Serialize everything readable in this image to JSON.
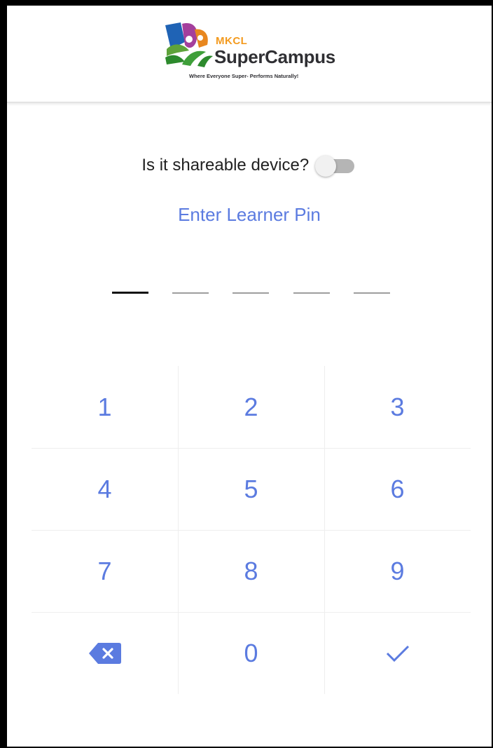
{
  "header": {
    "logo_mkcl": "MKCL",
    "logo_name": "SuperCampus",
    "logo_tagline": "Where Everyone Super- Performs Naturally!"
  },
  "share": {
    "label": "Is it shareable device?",
    "toggle_on": false
  },
  "pin": {
    "title": "Enter Learner Pin",
    "length": 5,
    "active_index": 0
  },
  "keypad": {
    "rows": [
      [
        "1",
        "2",
        "3"
      ],
      [
        "4",
        "5",
        "6"
      ],
      [
        "7",
        "8",
        "9"
      ],
      [
        "backspace-icon",
        "0",
        "check-icon"
      ]
    ]
  },
  "colors": {
    "accent": "#5b7be0",
    "text": "#212121",
    "toggle_track": "#b5b5b5"
  }
}
